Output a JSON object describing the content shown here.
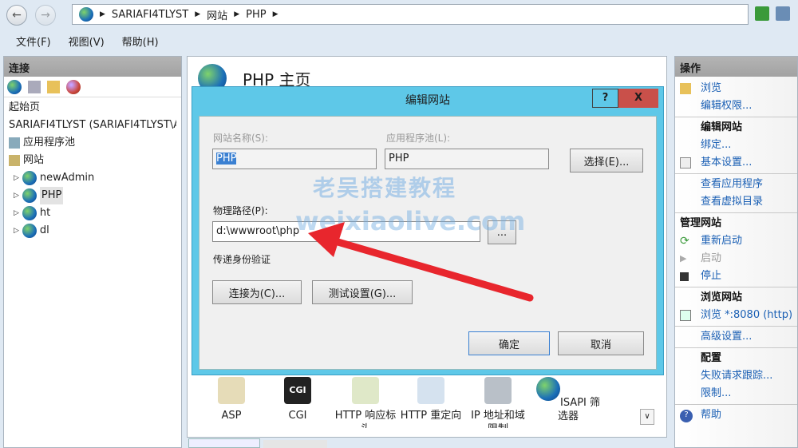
{
  "breadcrumb": [
    "SARIAFI4TLYST",
    "网站",
    "PHP"
  ],
  "menu": [
    "文件(F)",
    "视图(V)",
    "帮助(H)"
  ],
  "connections": {
    "title": "连接",
    "tree": [
      "起始页",
      "SARIAFI4TLYST (SARIAFI4TLYST\\A",
      "应用程序池",
      "网站",
      "newAdmin",
      "PHP",
      "ht",
      "dl"
    ]
  },
  "main": {
    "title": "PHP 主页",
    "features": [
      "ASP",
      "CGI",
      "HTTP 响应标头",
      "HTTP 重定向",
      "IP 地址和域限制",
      "ISAPI 筛选器"
    ],
    "feature_labels": [
      "ASP",
      "CGI",
      "HTTP 响应标",
      "HTTP 重定向",
      "IP 地址和域",
      "ISAPI 筛选器"
    ]
  },
  "dialog": {
    "title": "编辑网站",
    "help": "?",
    "close": "X",
    "site_name_label": "网站名称(S):",
    "site_name": "PHP",
    "app_pool_label": "应用程序池(L):",
    "app_pool": "PHP",
    "select_button": "选择(E)...",
    "physical_path_label": "物理路径(P):",
    "physical_path": "d:\\wwwroot\\php",
    "browse_button": "...",
    "pass_through_label": "传递身份验证",
    "connect_as_button": "连接为(C)...",
    "test_settings_button": "测试设置(G)...",
    "ok_button": "确定",
    "cancel_button": "取消"
  },
  "watermark": {
    "line1": "老吴搭建教程",
    "line2": "weixiaolive.com"
  },
  "actions": {
    "title": "操作",
    "items": [
      "浏览",
      "编辑权限...",
      "编辑网站",
      "绑定...",
      "基本设置...",
      "查看应用程序",
      "查看虚拟目录",
      "管理网站",
      "重新启动",
      "启动",
      "停止",
      "浏览网站",
      "浏览 *:8080 (http)",
      "高级设置...",
      "配置",
      "失败请求跟踪...",
      "限制...",
      "帮助"
    ]
  },
  "colors": {
    "dialog_title": "#5ec8e8",
    "close": "#c9504a",
    "link": "#1a5fb4",
    "arrow": "#e8262d"
  }
}
